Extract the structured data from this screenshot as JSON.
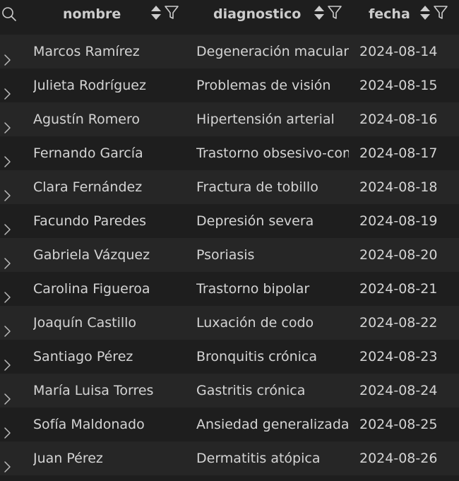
{
  "columns": {
    "nombre": "nombre",
    "diagnostico": "diagnostico",
    "fecha": "fecha"
  },
  "icons": {
    "search": "search-icon",
    "sort": "sort-icon",
    "filter": "filter-icon",
    "expand": "chevron-right-icon"
  },
  "colors": {
    "background": "#1e1e1e",
    "row_alt": "#262626",
    "text": "#d4d4d4",
    "header_text": "#cccccc"
  },
  "rows": [
    {
      "nombre": "Marcos Ramírez",
      "diagnostico": "Degeneración macular",
      "fecha": "2024-08-14"
    },
    {
      "nombre": "Julieta Rodríguez",
      "diagnostico": "Problemas de visión",
      "fecha": "2024-08-15"
    },
    {
      "nombre": "Agustín Romero",
      "diagnostico": "Hipertensión arterial",
      "fecha": "2024-08-16"
    },
    {
      "nombre": "Fernando García",
      "diagnostico": "Trastorno obsesivo-com",
      "fecha": "2024-08-17"
    },
    {
      "nombre": "Clara Fernández",
      "diagnostico": "Fractura de tobillo",
      "fecha": "2024-08-18"
    },
    {
      "nombre": "Facundo Paredes",
      "diagnostico": "Depresión severa",
      "fecha": "2024-08-19"
    },
    {
      "nombre": "Gabriela Vázquez",
      "diagnostico": "Psoriasis",
      "fecha": "2024-08-20"
    },
    {
      "nombre": "Carolina Figueroa",
      "diagnostico": "Trastorno bipolar",
      "fecha": "2024-08-21"
    },
    {
      "nombre": "Joaquín Castillo",
      "diagnostico": "Luxación de codo",
      "fecha": "2024-08-22"
    },
    {
      "nombre": "Santiago Pérez",
      "diagnostico": "Bronquitis crónica",
      "fecha": "2024-08-23"
    },
    {
      "nombre": "María Luisa Torres",
      "diagnostico": "Gastritis crónica",
      "fecha": "2024-08-24"
    },
    {
      "nombre": "Sofía Maldonado",
      "diagnostico": "Ansiedad generalizada",
      "fecha": "2024-08-25"
    },
    {
      "nombre": "Juan Pérez",
      "diagnostico": "Dermatitis atópica",
      "fecha": "2024-08-26"
    }
  ]
}
